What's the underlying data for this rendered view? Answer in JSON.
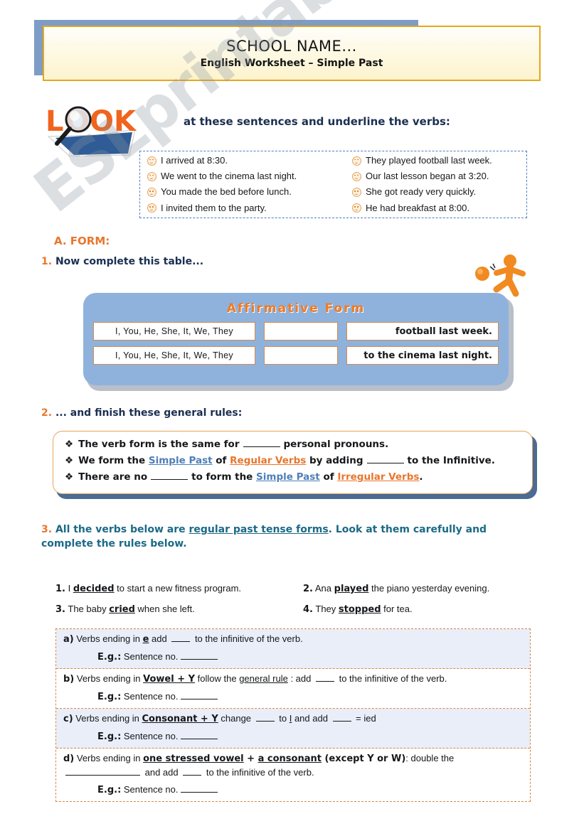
{
  "header": {
    "school_name": "SCHOOL NAME...",
    "subtitle": "English Worksheet – Simple Past"
  },
  "watermark": "ESLprintables.com",
  "look": {
    "logo_letters": "LOOK",
    "instruction": "at these sentences and underline the verbs:"
  },
  "sentences": {
    "left": [
      "I arrived at 8:30.",
      "We went to the cinema last night.",
      "You made the bed before lunch.",
      "I invited them to the party."
    ],
    "right": [
      "They played football last week.",
      "Our last lesson began at 3:20.",
      "She got ready very quickly.",
      "He had breakfast at 8:00."
    ]
  },
  "section_a": {
    "heading": "A. FORM:",
    "item1_num": "1.",
    "item1_text": "Now complete this table...",
    "table": {
      "title": "Affirmative Form",
      "rows": [
        {
          "pronouns": "I, You, He, She, It, We, They",
          "blank": "",
          "tail": "football last week."
        },
        {
          "pronouns": "I, You, He, She, It, We, They",
          "blank": "",
          "tail": "to the cinema last night."
        }
      ]
    },
    "item2_num": "2.",
    "item2_text": "... and finish these general rules:",
    "rules": {
      "bullet": "❖",
      "line1_a": "The verb form is the same for",
      "line1_b": "personal pronouns.",
      "line2_a": "We form the",
      "line2_sp": "Simple Past",
      "line2_of": "of",
      "line2_rv": "Regular Verbs",
      "line2_b": "by adding",
      "line2_c": "to the Infinitive.",
      "line3_a": "There are no",
      "line3_b": "to form the",
      "line3_sp": "Simple Past",
      "line3_of": "of",
      "line3_iv": "Irregular Verbs",
      "line3_end": "."
    },
    "item3_num": "3.",
    "item3_a": "All the verbs below are ",
    "item3_u": "regular past tense forms",
    "item3_b": ". Look at them carefully and complete the rules below.",
    "examples": [
      {
        "num": "1.",
        "pre": "I ",
        "verb": "decided",
        "post": " to start a new fitness program."
      },
      {
        "num": "2.",
        "pre": "Ana ",
        "verb": "played",
        "post": " the piano yesterday evening."
      },
      {
        "num": "3.",
        "pre": "The baby ",
        "verb": "cried",
        "post": " when she left."
      },
      {
        "num": "4.",
        "pre": "They ",
        "verb": "stopped",
        "post": " for tea."
      }
    ],
    "final_rules": [
      {
        "label": "a)",
        "p1": "Verbs ending in ",
        "bold_u": "e",
        "p2": " add ",
        "p3": " to the infinitive of the verb.",
        "eg_label": "E.g.:",
        "eg_text": "Sentence no."
      },
      {
        "label": "b)",
        "p1": "Verbs ending in ",
        "bold_u": "Vowel + Y",
        "p2": " follow the ",
        "u2": "general rule",
        "p3": " : add ",
        "p4": " to the infinitive of the verb.",
        "eg_label": "E.g.:",
        "eg_text": "Sentence no."
      },
      {
        "label": "c)",
        "p1": "Verbs ending in ",
        "bold_u": "Consonant + Y",
        "p2": " change ",
        "p3": " to ",
        "u3": "I",
        "p4": " and add ",
        "p5": " = ied",
        "eg_label": "E.g.:",
        "eg_text": "Sentence no."
      },
      {
        "label": "d)",
        "p1": "Verbs ending in ",
        "bold_u": "one stressed vowel",
        "plus": " + ",
        "bold_u2": "a consonant",
        "bold2": " (except Y or W)",
        "p2": ": double the",
        "p3": " and add ",
        "p4": " to the infinitive of the verb.",
        "eg_label": "E.g.:",
        "eg_text": "Sentence no."
      }
    ]
  },
  "colors": {
    "orange": "#e8762d",
    "dark_blue": "#1b2f52",
    "teal_blue": "#1b6a86",
    "table_blue": "#8fb2dd",
    "link_blue": "#4d7fb8",
    "dashed_orange": "#d4894a",
    "header_gold": "#e3a81e"
  }
}
